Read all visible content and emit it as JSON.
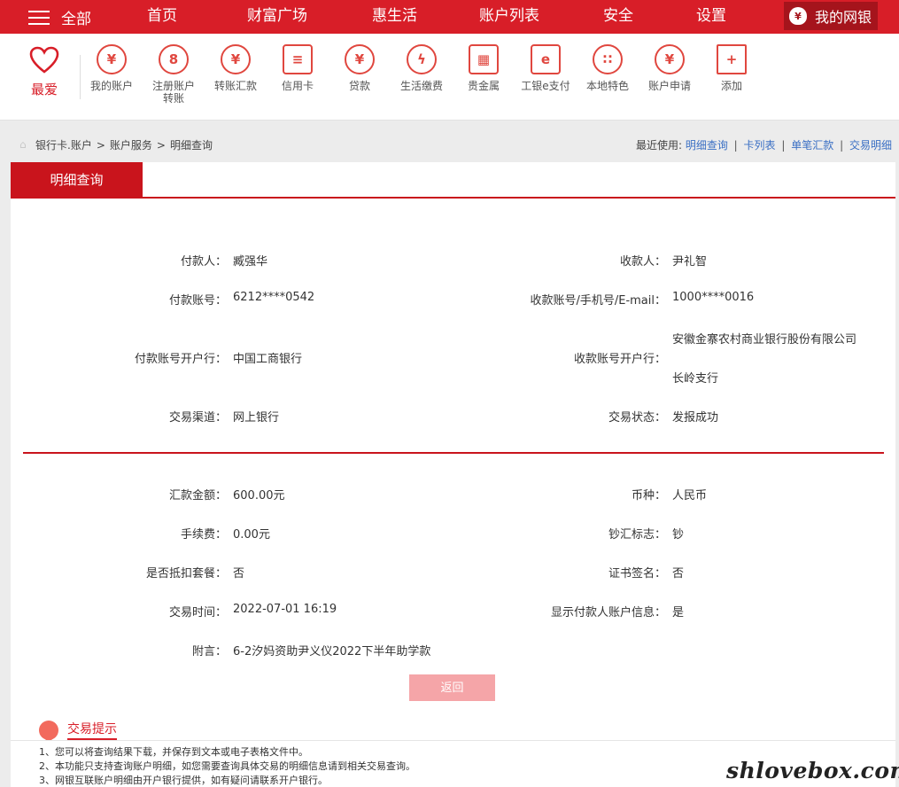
{
  "nav": {
    "all_label": "全部",
    "items": [
      "首页",
      "财富广场",
      "惠生活",
      "账户列表",
      "安全",
      "设置"
    ],
    "mybank_label": "我的网银"
  },
  "quickbar": {
    "fav_label": "最爱",
    "items": [
      {
        "label": "我的账户",
        "icon": "yen-circle-icon"
      },
      {
        "label": "注册账户转账",
        "icon": "transfer-icon"
      },
      {
        "label": "转账汇款",
        "icon": "remit-icon"
      },
      {
        "label": "信用卡",
        "icon": "credit-card-icon"
      },
      {
        "label": "贷款",
        "icon": "loan-bag-icon"
      },
      {
        "label": "生活缴费",
        "icon": "utility-icon"
      },
      {
        "label": "贵金属",
        "icon": "gold-bars-icon"
      },
      {
        "label": "工银e支付",
        "icon": "epay-icon"
      },
      {
        "label": "本地特色",
        "icon": "local-icon"
      },
      {
        "label": "账户申请",
        "icon": "apply-icon"
      },
      {
        "label": "添加",
        "icon": "plus-icon"
      }
    ]
  },
  "breadcrumb": {
    "items": [
      "银行卡.账户",
      "账户服务",
      "明细查询"
    ]
  },
  "recent": {
    "label": "最近使用:",
    "links": [
      "明细查询",
      "卡列表",
      "单笔汇款",
      "交易明细"
    ]
  },
  "tab": "明细查询",
  "details": {
    "payer_label": "付款人：",
    "payer": "臧强华",
    "payee_label": "收款人：",
    "payee": "尹礼智",
    "payer_account_label": "付款账号：",
    "payer_account": "6212****0542",
    "payee_account_label": "收款账号/手机号/E-mail：",
    "payee_account": "1000****0016",
    "payer_bank_label": "付款账号开户行：",
    "payer_bank": "中国工商银行",
    "payee_bank_label": "收款账号开户行：",
    "payee_bank_line1": "安徽金寨农村商业银行股份有限公司",
    "payee_bank_line2": "长岭支行",
    "channel_label": "交易渠道：",
    "channel": "网上银行",
    "status_label": "交易状态：",
    "status": "发报成功",
    "amount_label": "汇款金额：",
    "amount": "600.00元",
    "currency_label": "币种：",
    "currency": "人民币",
    "fee_label": "手续费：",
    "fee": "0.00元",
    "cash_flag_label": "钞汇标志：",
    "cash_flag": "钞",
    "package_label": "是否抵扣套餐：",
    "package": "否",
    "cert_label": "证书签名：",
    "cert": "否",
    "time_label": "交易时间：",
    "time": "2022-07-01 16:19",
    "show_payer_label": "显示付款人账户信息：",
    "show_payer": "是",
    "note_label": "附言：",
    "note": "6-2汐妈资助尹义仪2022下半年助学款"
  },
  "back_button": "返回",
  "tips": {
    "title": "交易提示",
    "items": [
      "1、您可以将查询结果下载，并保存到文本或电子表格文件中。",
      "2、本功能只支持查询账户明细，如您需要查询具体交易的明细信息请到相关交易查询。",
      "3、网银互联账户明细由开户银行提供，如有疑问请联系开户银行。"
    ]
  },
  "watermark": "shlovebox.com",
  "colors": {
    "brand_red": "#d81e28",
    "tab_red": "#c9141c",
    "link_blue": "#3a6fc4"
  }
}
